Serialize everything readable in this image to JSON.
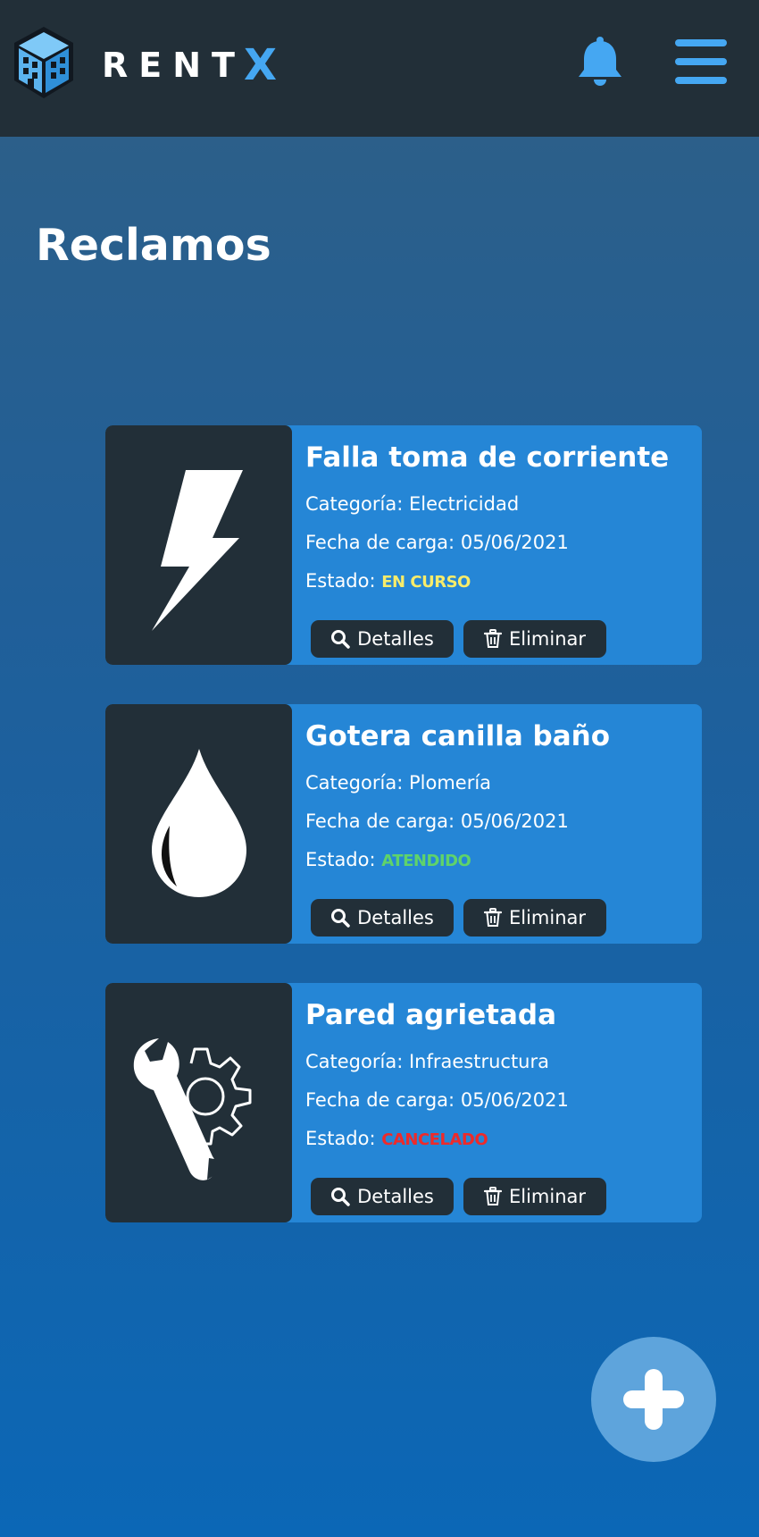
{
  "header": {
    "brand_prefix": "RENT",
    "brand_suffix": "X",
    "logo_icon": "building-cube-icon",
    "notification_icon": "bell-icon",
    "menu_icon": "hamburger-menu-icon"
  },
  "page": {
    "title": "Reclamos"
  },
  "claims": [
    {
      "title": "Falla toma de corriente",
      "icon": "lightning-icon",
      "category_label": "Categoría:",
      "category": "Electricidad",
      "date_label": "Fecha de carga:",
      "date": "05/06/2021",
      "status_label": "Estado:",
      "status": "EN CURSO",
      "status_color": "#f7ec6a",
      "details_label": "Detalles",
      "delete_label": "Eliminar"
    },
    {
      "title": "Gotera canilla baño",
      "icon": "water-drop-icon",
      "category_label": "Categoría:",
      "category": "Plomería",
      "date_label": "Fecha de carga:",
      "date": "05/06/2021",
      "status_label": "Estado:",
      "status": "ATENDIDO",
      "status_color": "#5fd36a",
      "details_label": "Detalles",
      "delete_label": "Eliminar"
    },
    {
      "title": "Pared agrietada",
      "icon": "wrench-gear-icon",
      "category_label": "Categoría:",
      "category": "Infraestructura",
      "date_label": "Fecha de carga:",
      "date": "05/06/2021",
      "status_label": "Estado:",
      "status": "CANCELADO",
      "status_color": "#ee2a2a",
      "details_label": "Detalles",
      "delete_label": "Eliminar"
    }
  ],
  "actions": {
    "add_icon": "plus-icon"
  },
  "colors": {
    "topbar": "#222f38",
    "card": "#2586d6",
    "accent": "#45a7f2",
    "fab": "#5ea4dc"
  }
}
